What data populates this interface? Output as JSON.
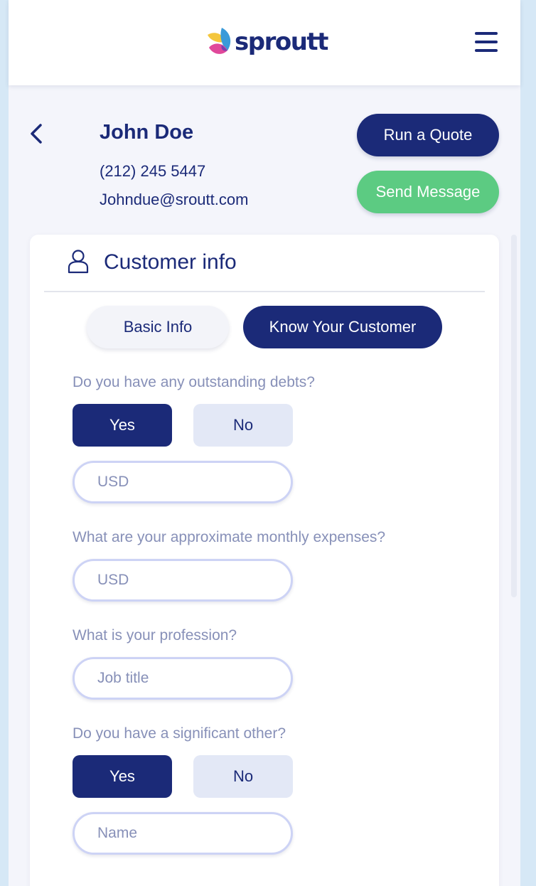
{
  "header": {
    "brand": "sproutt",
    "menu_icon": "hamburger-menu-icon"
  },
  "contact": {
    "back_icon": "chevron-left-icon",
    "name": "John Doe",
    "phone": "(212) 245 5447",
    "email": "Johndue@sroutt.com"
  },
  "actions": {
    "run_quote": "Run a Quote",
    "send_message": "Send Message"
  },
  "card": {
    "icon": "user-icon",
    "title": "Customer info",
    "tabs": [
      {
        "label": "Basic Info",
        "active": false
      },
      {
        "label": "Know Your Customer",
        "active": true
      }
    ]
  },
  "form": {
    "debts": {
      "question": "Do you have any outstanding debts?",
      "yes": "Yes",
      "no": "No",
      "selected": "Yes",
      "placeholder": "USD"
    },
    "expenses": {
      "question": "What are your approximate monthly expenses?",
      "placeholder": "USD"
    },
    "profession": {
      "question": "What is your profession?",
      "placeholder": "Job title"
    },
    "significant_other": {
      "question": "Do you have a significant other?",
      "yes": "Yes",
      "no": "No",
      "selected": "Yes",
      "placeholder": "Name"
    }
  },
  "colors": {
    "navy": "#1b2a78",
    "green": "#5ccb82",
    "muted_text": "#8790b8",
    "background": "#d6e8f6"
  }
}
